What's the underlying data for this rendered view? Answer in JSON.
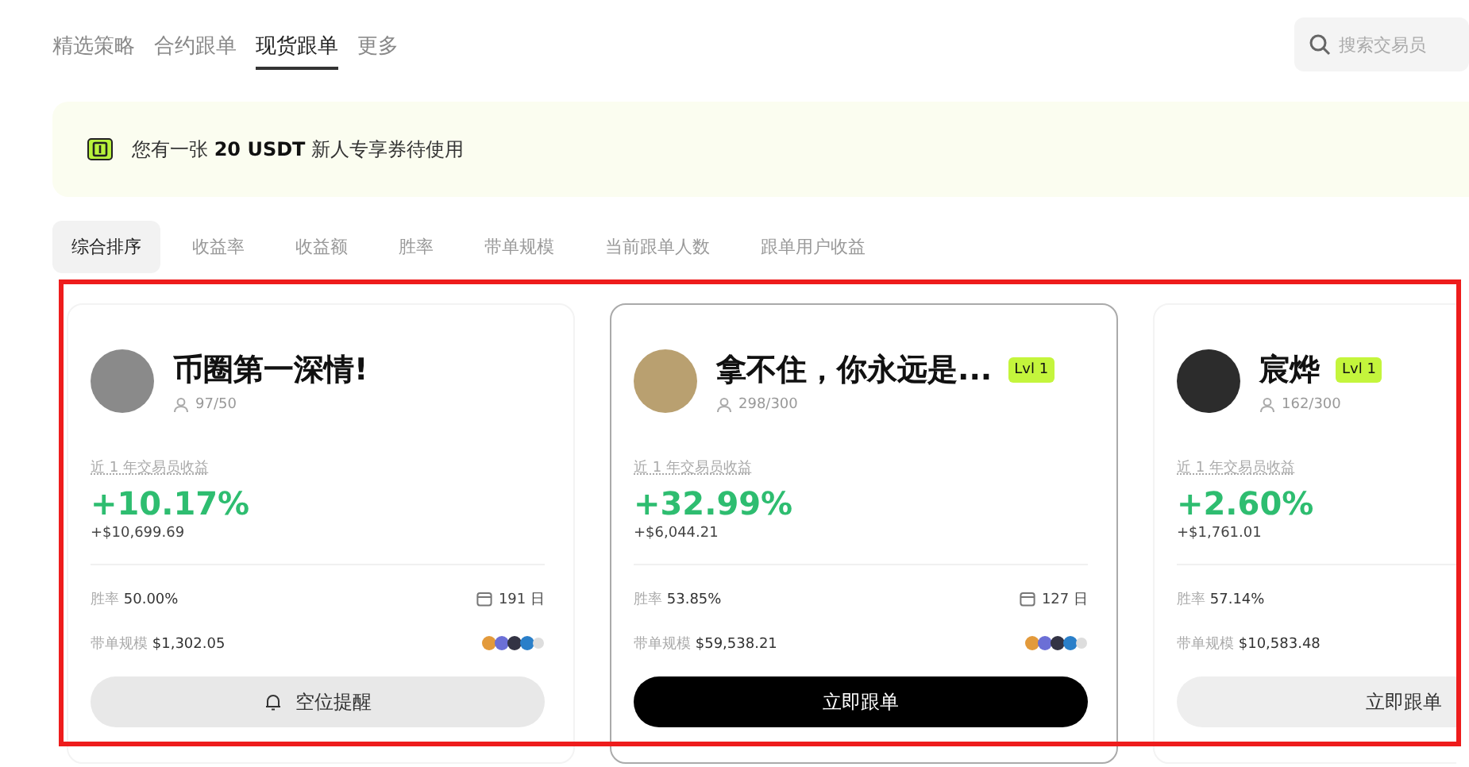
{
  "nav": {
    "tabs": [
      {
        "label": "精选策略",
        "selected": false
      },
      {
        "label": "合约跟单",
        "selected": false
      },
      {
        "label": "现货跟单",
        "selected": true
      },
      {
        "label": "更多",
        "selected": false
      }
    ],
    "search": {
      "placeholder": "搜索交易员"
    }
  },
  "banner": {
    "text": "您有一张 **20 USDT** 新人专享券待使用"
  },
  "sort_tabs": [
    {
      "label": "综合排序",
      "selected": true
    },
    {
      "label": "收益率",
      "selected": false
    },
    {
      "label": "收益额",
      "selected": false
    },
    {
      "label": "胜率",
      "selected": false
    },
    {
      "label": "带单规模",
      "selected": false
    },
    {
      "label": "当前跟单人数",
      "selected": false
    },
    {
      "label": "跟单用户收益",
      "selected": false
    }
  ],
  "traders": [
    {
      "name": "币圈第一深情!",
      "followers": "97/50",
      "roi_label": "近 1 年交易员收益",
      "roi": "+10.17%",
      "pnl": "+$10,699.69",
      "win_rate_label": "胜率",
      "win_rate": "50.00%",
      "days": "191 日",
      "scale_label": "带单规模",
      "scale": "$1,302.05",
      "coin_icons": true,
      "hovered": false,
      "button": {
        "label": "空位提醒",
        "kind": "notify"
      }
    },
    {
      "name": "拿不住，你永远是...",
      "level": "Lvl 1",
      "followers": "298/300",
      "roi_label": "近 1 年交易员收益",
      "roi": "+32.99%",
      "pnl": "+$6,044.21",
      "win_rate_label": "胜率",
      "win_rate": "53.85%",
      "days": "127 日",
      "scale_label": "带单规模",
      "scale": "$59,538.21",
      "coin_icons": true,
      "hovered": true,
      "button": {
        "label": "立即跟单",
        "kind": "primary"
      }
    },
    {
      "name": "宸烨",
      "level": "Lvl 1",
      "followers": "162/300",
      "roi_label": "近 1 年交易员收益",
      "roi": "+2.60%",
      "pnl": "+$1,761.01",
      "win_rate_label": "胜率",
      "win_rate": "57.14%",
      "scale_label": "带单规模",
      "scale": "$10,583.48",
      "hovered": false,
      "button": {
        "label": "立即跟单",
        "kind": "secondary"
      }
    }
  ]
}
